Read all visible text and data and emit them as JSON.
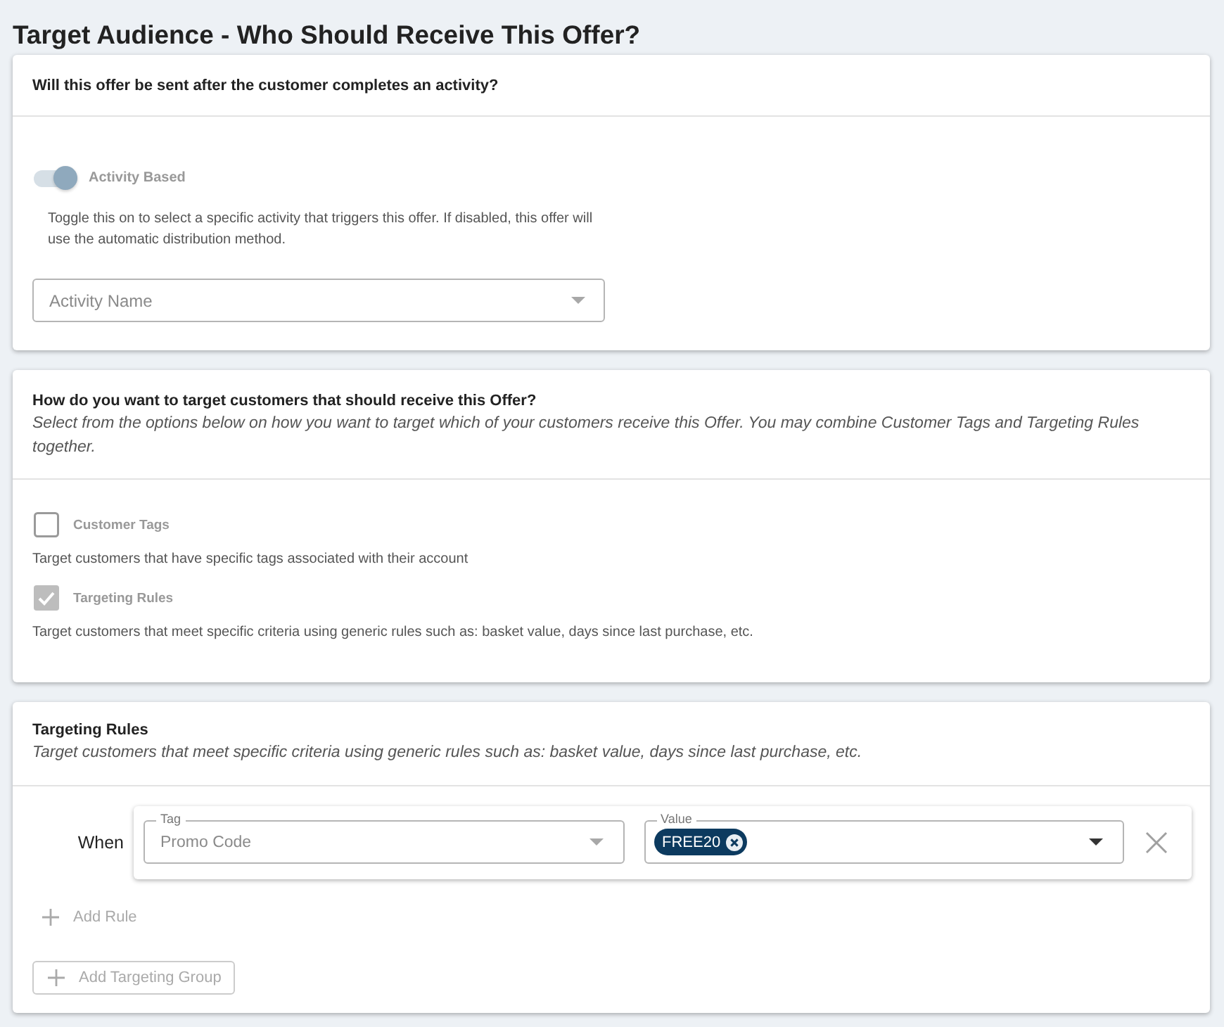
{
  "page_title": "Target Audience - Who Should Receive This Offer?",
  "activity_section": {
    "question": "Will this offer be sent after the customer completes an activity?",
    "toggle": {
      "label": "Activity Based",
      "on": true,
      "disabled": true
    },
    "help_text": "Toggle this on to select a specific activity that triggers this offer. If disabled, this offer will use the automatic distribution method.",
    "activity_select": {
      "placeholder": "Activity Name"
    }
  },
  "targeting_section": {
    "question": "How do you want to target customers that should receive this Offer?",
    "description": "Select from the options below on how you want to target which of your customers receive this Offer. You may combine Customer Tags and Targeting Rules together.",
    "options": [
      {
        "label": "Customer Tags",
        "checked": false,
        "disabled": true,
        "description": "Target customers that have specific tags associated with their account"
      },
      {
        "label": "Targeting Rules",
        "checked": true,
        "disabled": true,
        "description": "Target customers that meet specific criteria using generic rules such as: basket value, days since last purchase, etc."
      }
    ]
  },
  "rules_section": {
    "title": "Targeting Rules",
    "description": "Target customers that meet specific criteria using generic rules such as: basket value, days since last purchase, etc.",
    "rules": [
      {
        "connector": "When",
        "tag_field": {
          "label": "Tag",
          "value": "Promo Code",
          "disabled": true
        },
        "value_field": {
          "label": "Value",
          "chips": [
            "FREE20"
          ],
          "disabled": false
        }
      }
    ],
    "add_rule": {
      "label": "Add Rule",
      "disabled": true
    },
    "add_group": {
      "label": "Add Targeting Group",
      "disabled": true
    }
  }
}
